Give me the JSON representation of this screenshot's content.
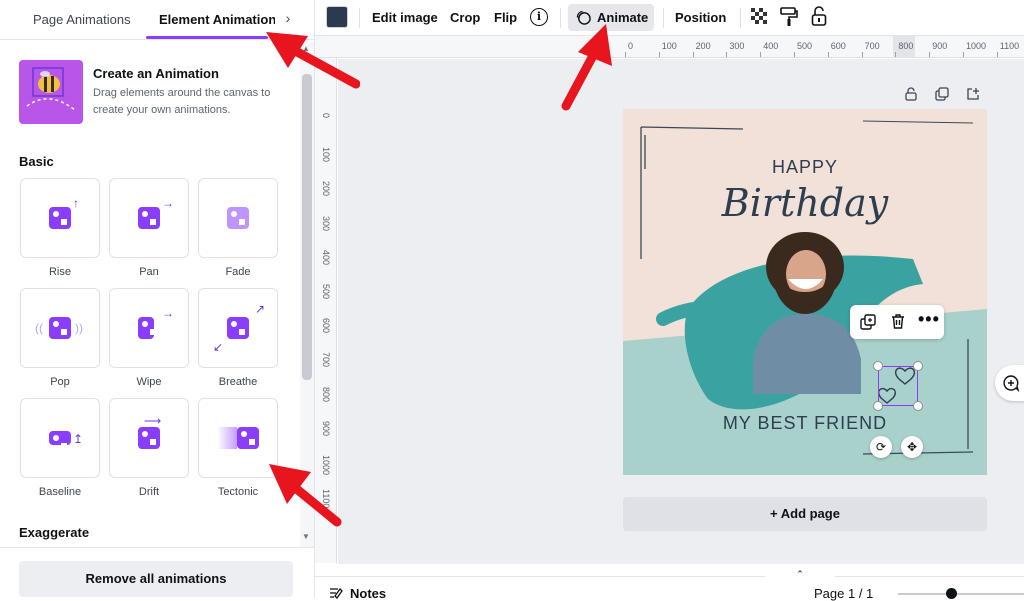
{
  "left_panel": {
    "tabs": [
      {
        "label": "Page Animations",
        "active": false
      },
      {
        "label": "Element Animations",
        "active": true
      }
    ],
    "create": {
      "title": "Create an Animation",
      "description": "Drag elements around the canvas to create your own animations."
    },
    "section_basic": "Basic",
    "basic_animations": [
      "Rise",
      "Pan",
      "Fade",
      "Pop",
      "Wipe",
      "Breathe",
      "Baseline",
      "Drift",
      "Tectonic"
    ],
    "section_exaggerate": "Exaggerate",
    "remove_button": "Remove all animations"
  },
  "toolbar": {
    "swatch_color": "#2b3a4e",
    "edit_image": "Edit image",
    "crop": "Crop",
    "flip": "Flip",
    "animate": "Animate",
    "position": "Position"
  },
  "ruler": {
    "horizontal": [
      "0",
      "100",
      "200",
      "300",
      "400",
      "500",
      "600",
      "700",
      "800",
      "900",
      "1000",
      "1100"
    ],
    "vertical": [
      "0",
      "100",
      "200",
      "300",
      "400",
      "500",
      "600",
      "700",
      "800",
      "900",
      "1000",
      "1100"
    ]
  },
  "canvas": {
    "card": {
      "line1": "HAPPY",
      "line2": "Birthday",
      "line3": "MY BEST FRIEND"
    },
    "add_page": "+ Add page"
  },
  "bottom_bar": {
    "notes": "Notes",
    "page_count": "Page 1 / 1",
    "zoom_level": 0.42
  },
  "colors": {
    "accent": "#8b3dff",
    "arrow": "#e8141e",
    "teal": "#3aa3a2"
  }
}
